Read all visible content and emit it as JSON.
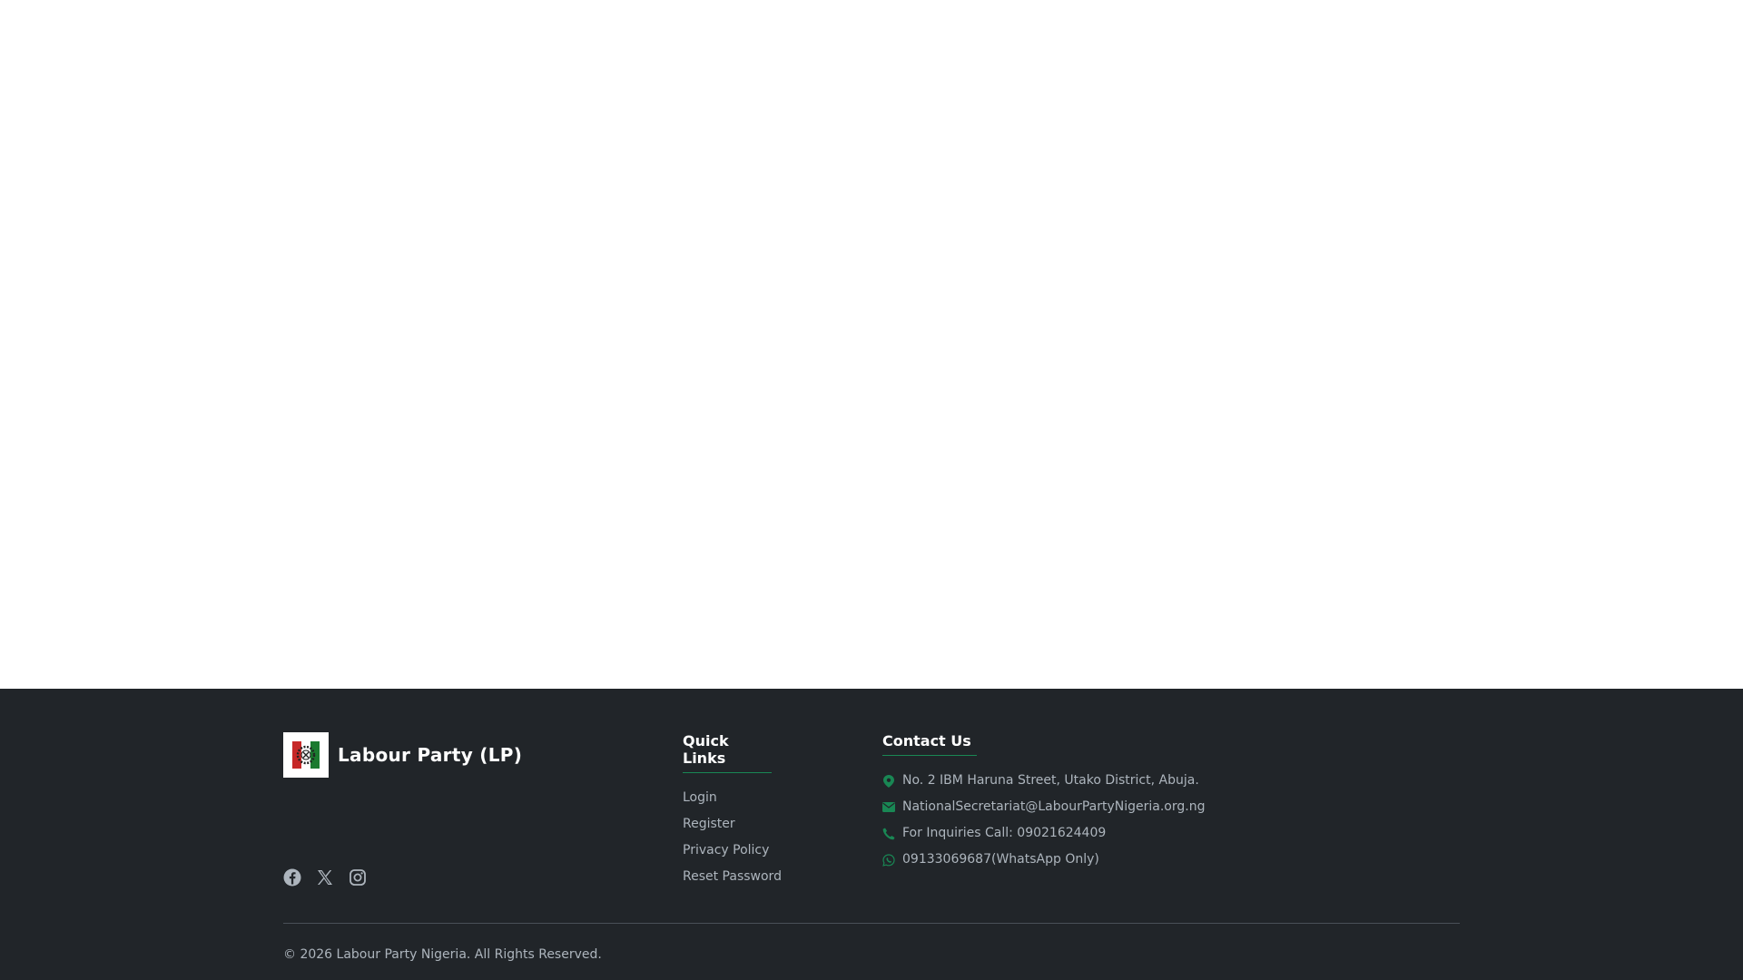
{
  "footer": {
    "brand_name": "Labour Party (LP)",
    "social": [
      "facebook-icon",
      "x-icon",
      "instagram-icon"
    ],
    "quick_links": {
      "heading": "Quick Links",
      "items": [
        "Login",
        "Register",
        "Privacy Policy",
        "Reset Password"
      ]
    },
    "contact": {
      "heading": "Contact Us",
      "address": "No. 2 IBM Haruna Street, Utako District, Abuja.",
      "email": "NationalSecretariat@LabourPartyNigeria.org.ng",
      "phone": "For Inquiries Call: 09021624409",
      "whatsapp": "09133069687(WhatsApp Only)"
    },
    "copyright": "© 2026 Labour Party Nigeria. All Rights Reserved."
  },
  "colors": {
    "footer_bg": "#212529",
    "accent_green": "#198754",
    "muted_text": "#adb5bd"
  }
}
